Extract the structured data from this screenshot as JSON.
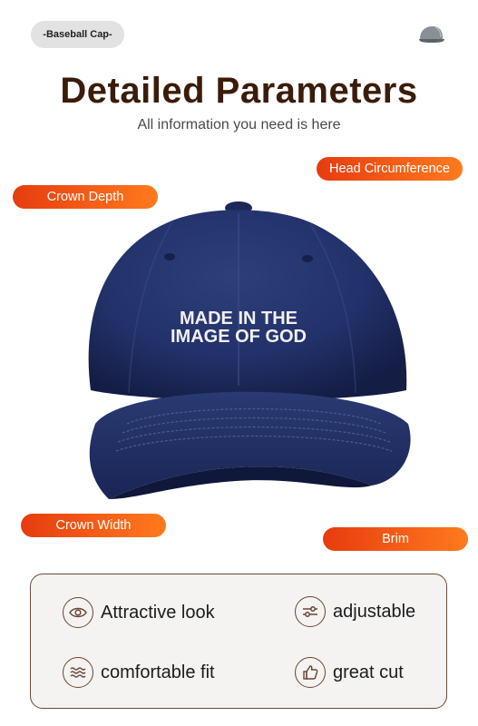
{
  "header": {
    "category_pill": "-Baseball Cap-",
    "title": "Detailed Parameters",
    "subtitle": "All information you need is here"
  },
  "product": {
    "embroidery_line1": "MADE IN THE",
    "embroidery_line2": "IMAGE OF GOD",
    "color": "#1f2d5c"
  },
  "tags": {
    "head_circumference": "Head Circumference",
    "crown_depth": "Crown Depth",
    "crown_width": "Crown Width",
    "brim": "Brim"
  },
  "features": [
    {
      "label": "Attractive look",
      "icon": "eye-icon"
    },
    {
      "label": "adjustable",
      "icon": "sliders-icon"
    },
    {
      "label": "comfortable fit",
      "icon": "waves-icon"
    },
    {
      "label": "great cut",
      "icon": "thumbs-up-icon"
    }
  ],
  "colors": {
    "title": "#3b1c0a",
    "tag_start": "#e63c0f",
    "tag_end": "#ff7a1e"
  }
}
